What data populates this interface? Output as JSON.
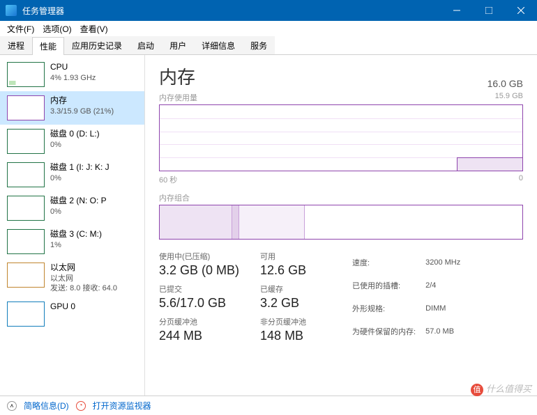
{
  "window": {
    "title": "任务管理器"
  },
  "menu": {
    "file": "文件(F)",
    "options": "选项(O)",
    "view": "查看(V)"
  },
  "tabs": [
    "进程",
    "性能",
    "应用历史记录",
    "启动",
    "用户",
    "详细信息",
    "服务"
  ],
  "active_tab": 1,
  "sidebar": {
    "items": [
      {
        "name": "CPU",
        "sub": "4% 1.93 GHz",
        "kind": "cpu"
      },
      {
        "name": "内存",
        "sub": "3.3/15.9 GB (21%)",
        "kind": "mem",
        "selected": true
      },
      {
        "name": "磁盘 0 (D: L:)",
        "sub": "0%",
        "kind": "disk"
      },
      {
        "name": "磁盘 1 (I: J: K: J",
        "sub": "0%",
        "kind": "disk"
      },
      {
        "name": "磁盘 2 (N: O: P",
        "sub": "0%",
        "kind": "disk"
      },
      {
        "name": "磁盘 3 (C: M:)",
        "sub": "1%",
        "kind": "disk"
      },
      {
        "name": "以太网",
        "sub": "以太网",
        "sub2": "发送: 8.0 接收: 64.0",
        "kind": "eth"
      },
      {
        "name": "GPU 0",
        "sub": "",
        "kind": "gpu"
      }
    ]
  },
  "main": {
    "title": "内存",
    "total": "16.0 GB",
    "usage_label": "内存使用量",
    "usage_max": "15.9 GB",
    "xaxis_left": "60 秒",
    "xaxis_right": "0",
    "composition_label": "内存组合",
    "stats": {
      "in_use_label": "使用中(已压缩)",
      "in_use": "3.2 GB (0 MB)",
      "available_label": "可用",
      "available": "12.6 GB",
      "committed_label": "已提交",
      "committed": "5.6/17.0 GB",
      "cached_label": "已缓存",
      "cached": "3.2 GB",
      "paged_label": "分页缓冲池",
      "paged": "244 MB",
      "nonpaged_label": "非分页缓冲池",
      "nonpaged": "148 MB"
    },
    "meta": {
      "speed_label": "速度:",
      "speed": "3200 MHz",
      "slots_label": "已使用的插槽:",
      "slots": "2/4",
      "form_label": "外形规格:",
      "form": "DIMM",
      "reserved_label": "为硬件保留的内存:",
      "reserved": "57.0 MB"
    }
  },
  "statusbar": {
    "fewer": "简略信息(D)",
    "resmon": "打开资源监视器"
  },
  "watermark": "什么值得买",
  "chart_data": {
    "type": "area",
    "title": "内存使用量",
    "ylabel": "GB",
    "ylim": [
      0,
      15.9
    ],
    "xlabel": "秒",
    "xlim": [
      60,
      0
    ],
    "series": [
      {
        "name": "使用中",
        "values_gb_approx": [
          0,
          0,
          0,
          0,
          0,
          0,
          0,
          0,
          0,
          0,
          3.2,
          3.3,
          3.3,
          3.3,
          3.3
        ]
      }
    ],
    "composition": {
      "in_use_gb": 3.2,
      "modified_gb": 0.1,
      "standby_gb": 3.2,
      "free_gb": 9.4,
      "total_gb": 15.9
    }
  }
}
